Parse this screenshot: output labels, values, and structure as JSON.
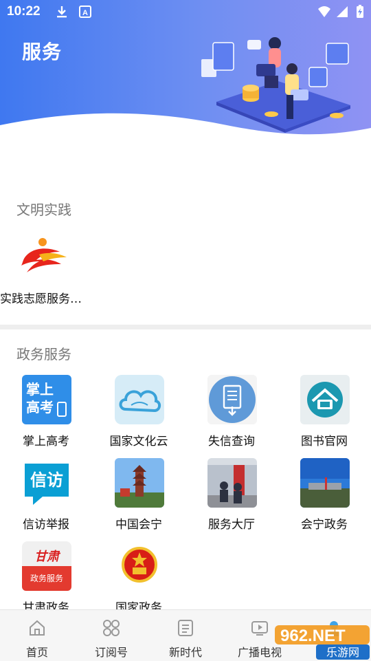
{
  "status_bar": {
    "time": "10:22",
    "left_icons": [
      "download-icon",
      "font-a-icon"
    ],
    "right_icons": [
      "wifi-icon",
      "signal-icon",
      "battery-icon"
    ]
  },
  "header": {
    "title": "服务",
    "gradient_start": "#3f78f0",
    "gradient_end": "#8f92f3"
  },
  "wenming": {
    "section_title": "文明实践",
    "items": [
      {
        "label": "实践志愿服务…",
        "icon": "volunteer-logo-icon"
      }
    ]
  },
  "zhengwu": {
    "section_title": "政务服务",
    "items": [
      {
        "label": "掌上高考",
        "icon": "gaokao-icon",
        "icon_text": "掌上 高考"
      },
      {
        "label": "国家文化云",
        "icon": "culture-cloud-icon"
      },
      {
        "label": "失信查询",
        "icon": "document-download-icon"
      },
      {
        "label": "图书官网",
        "icon": "library-icon"
      },
      {
        "label": "信访举报",
        "icon": "xinfang-icon",
        "icon_text": "信访"
      },
      {
        "label": "中国会宁",
        "icon": "tower-photo-icon"
      },
      {
        "label": "服务大厅",
        "icon": "service-hall-photo-icon"
      },
      {
        "label": "会宁政务",
        "icon": "huining-photo-icon"
      },
      {
        "label": "甘肃政务",
        "icon": "gansu-icon",
        "icon_text_top": "甘肃",
        "icon_text_bottom": "政务服务"
      },
      {
        "label": "国家政务",
        "icon": "national-emblem-icon"
      }
    ]
  },
  "bottom_nav": {
    "items": [
      {
        "label": "首页",
        "icon": "home-icon"
      },
      {
        "label": "订阅号",
        "icon": "subscribe-icon"
      },
      {
        "label": "新时代",
        "icon": "news-icon"
      },
      {
        "label": "广播电视",
        "icon": "tv-icon"
      },
      {
        "label": "",
        "icon": "profile-icon"
      }
    ]
  },
  "watermark": {
    "top": "962.NET",
    "bottom": "乐游网"
  }
}
